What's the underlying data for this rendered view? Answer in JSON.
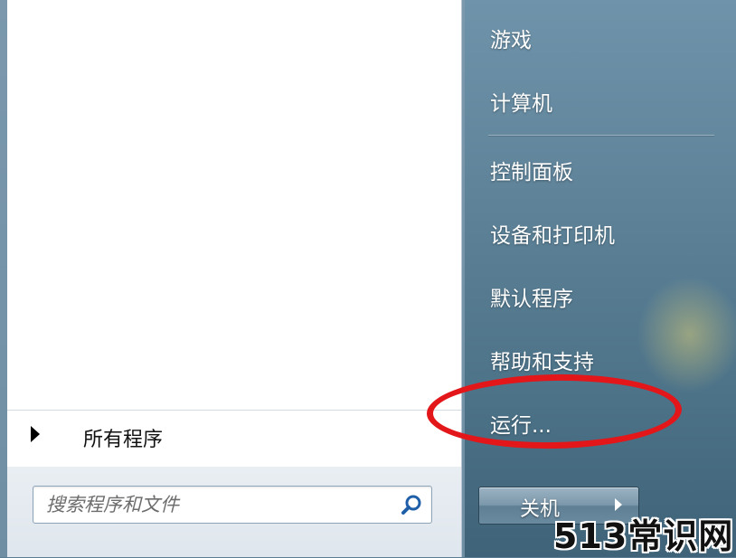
{
  "right_menu": {
    "items": [
      {
        "label": "游戏"
      },
      {
        "label": "计算机"
      },
      {
        "label": "控制面板"
      },
      {
        "label": "设备和打印机"
      },
      {
        "label": "默认程序"
      },
      {
        "label": "帮助和支持"
      },
      {
        "label": "运行..."
      }
    ]
  },
  "left_menu": {
    "all_programs_label": "所有程序"
  },
  "search": {
    "placeholder": "搜索程序和文件",
    "icon": "search-icon"
  },
  "shutdown": {
    "label": "关机",
    "arrow_icon": "chevron-right-icon"
  },
  "annotation": {
    "color": "#e3161a"
  },
  "watermark": {
    "text": "513常识网"
  }
}
